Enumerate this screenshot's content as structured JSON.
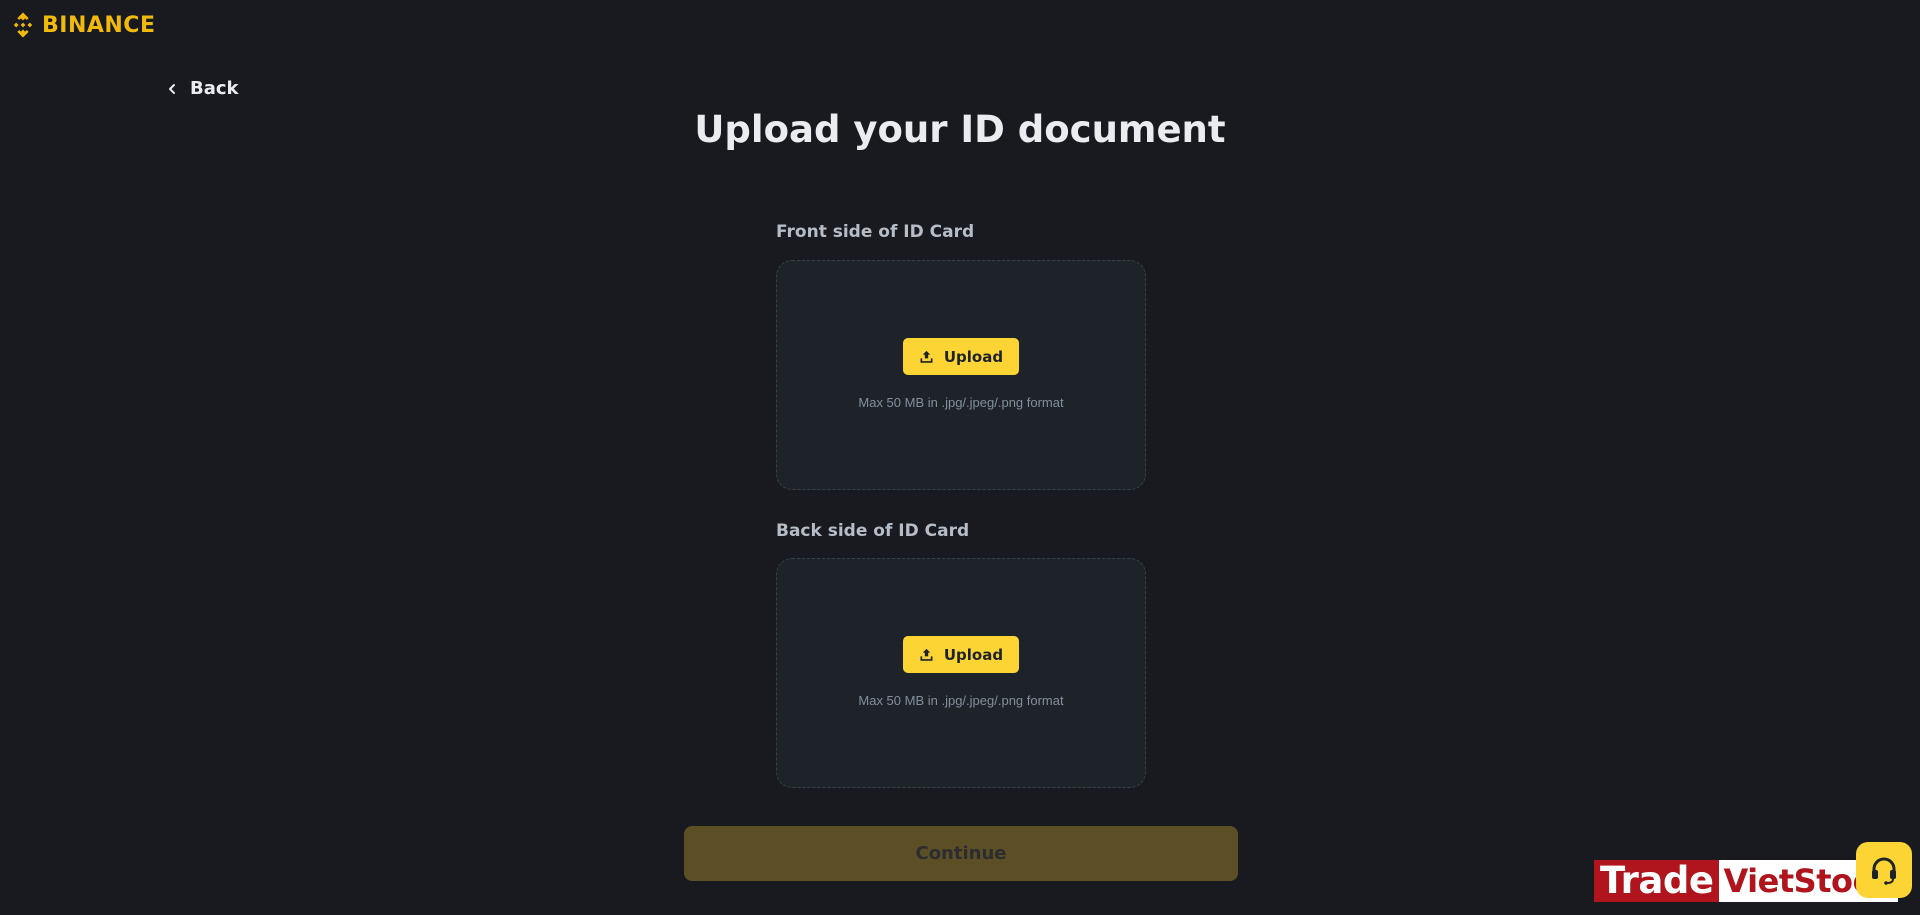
{
  "brand": {
    "name": "BINANCE",
    "color": "#f0b90b"
  },
  "nav": {
    "back_label": "Back",
    "back_icon": "chevron-left-icon"
  },
  "page": {
    "title": "Upload your ID document"
  },
  "front": {
    "label": "Front side of ID Card",
    "upload_label": "Upload",
    "upload_icon": "upload-icon",
    "hint": "Max 50 MB in .jpg/.jpeg/.png format"
  },
  "back": {
    "label": "Back side of ID Card",
    "upload_label": "Upload",
    "upload_icon": "upload-icon",
    "hint": "Max 50 MB in .jpg/.jpeg/.png format"
  },
  "actions": {
    "continue_label": "Continue",
    "continue_enabled": false
  },
  "watermark": {
    "part1": "Trade",
    "part2": "VietStock"
  },
  "support": {
    "icon": "headset-icon"
  },
  "colors": {
    "background": "#181a20",
    "card": "#1e2329",
    "accent": "#fcd535",
    "accent_disabled": "#5c4f26",
    "muted_text": "#848e9c"
  }
}
